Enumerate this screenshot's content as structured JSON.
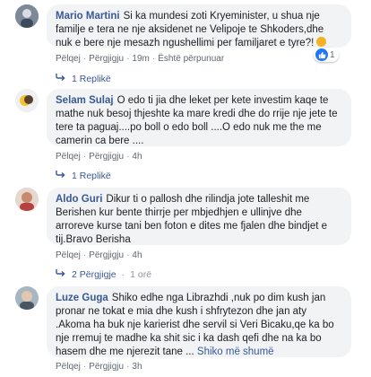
{
  "comments": [
    {
      "author": "Mario Martini",
      "text": "Si ka mundesi zoti Kryeminister, u shua nje familje e tera ne nje aksidenet ne Velipoje te Shkoders,dhe nuk e bere nje mesazh ngushellimi per familjaret e tyre?!",
      "like": "Pëlqej",
      "reply": "Përgjigju",
      "time": "19m",
      "edited": "Është përpunuar",
      "reaction_count": "1",
      "replies": "1 Replikë"
    },
    {
      "author": "Selam Sulaj",
      "text": "O edo ti jia dhe leket per kete investim kaqe te mathe nuk besoj thjeshte ka mare kredi dhe do rrije nje jete te tere ta paguaj....po boll o edo boll ....O edo nuk me the me camerin ca bere ....",
      "like": "Pëlqej",
      "reply": "Përgjigju",
      "time": "4h",
      "replies": "1 Replikë"
    },
    {
      "author": "Aldo Guri",
      "text": "Dikur ti o pallosh dhe rilindja jote talleshit me Berishen kur bente thirrje per mbjedhjen e ullinjve dhe arroreve kurse tani ben foton e dites me fjalen dhe bindjet e tij.Bravo Berisha",
      "like": "Pëlqej",
      "reply": "Përgjigju",
      "time": "4h",
      "replies": "2 Përgjigje",
      "replies_time": "1 orë"
    },
    {
      "author": "Luze Guga",
      "text": "Shiko edhe nga Librazhdi ,nuk po dim kush jan pronar ne tokat e mia dhe kush i shfrytezon dhe jan aty .Akoma ha buk nje karierist dhe servil si Veri Bicaku,qe ka bo nje rremuj te madhe ka shit sic i ka dash qefi dhe na ka bo hasem dhe me njerezit tane ...",
      "more": "Shiko më shumë",
      "like": "Pëlqej",
      "reply": "Përgjigju",
      "time": "3h"
    }
  ],
  "colors": {
    "author": "#385898",
    "bubble": "#f2f3f5",
    "like_blue": "#2078f4",
    "emoji": "#f7b125"
  }
}
